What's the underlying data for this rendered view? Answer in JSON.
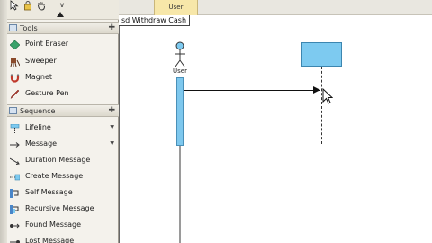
{
  "palette": {
    "toolbar": {
      "tool_v": "v"
    },
    "tools_group": {
      "title": "Tools",
      "items": [
        {
          "label": "Point Eraser",
          "icon": "eraser-icon",
          "color": "#3aa36b"
        },
        {
          "label": "Sweeper",
          "icon": "sweeper-icon",
          "color": "#8a4a2a"
        },
        {
          "label": "Magnet",
          "icon": "magnet-icon",
          "color": "#c0392b"
        },
        {
          "label": "Gesture Pen",
          "icon": "pen-icon",
          "color": "#b03a2e"
        }
      ]
    },
    "sequence_group": {
      "title": "Sequence",
      "items": [
        {
          "label": "Lifeline",
          "icon": "lifeline-icon",
          "has_submenu": true
        },
        {
          "label": "Message",
          "icon": "message-icon",
          "has_submenu": true
        },
        {
          "label": "Duration Message",
          "icon": "duration-message-icon"
        },
        {
          "label": "Create Message",
          "icon": "create-message-icon"
        },
        {
          "label": "Self Message",
          "icon": "self-message-icon"
        },
        {
          "label": "Recursive Message",
          "icon": "recursive-message-icon"
        },
        {
          "label": "Found Message",
          "icon": "found-message-icon"
        },
        {
          "label": "Lost Message",
          "icon": "lost-message-icon"
        }
      ]
    }
  },
  "diagram": {
    "tab_user": "User",
    "frame_label": "sd Withdraw Cash",
    "actor_label": "User",
    "accent": "#7dcaf0"
  }
}
